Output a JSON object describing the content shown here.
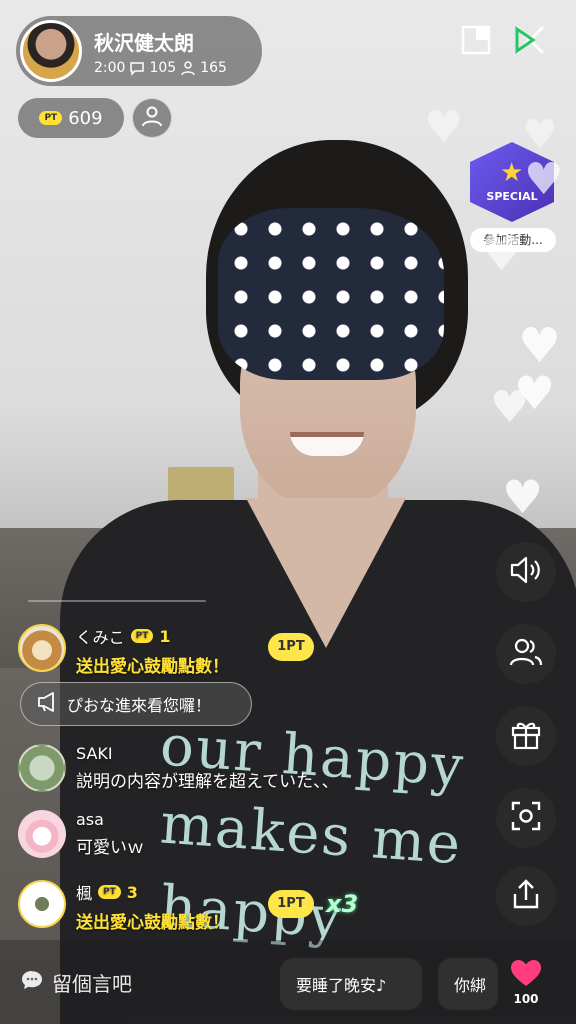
{
  "host": {
    "name": "秋沢健太朗",
    "duration": "2:00",
    "comments_count": "105",
    "viewers_count": "165"
  },
  "points": {
    "badge": "PT",
    "value": "609"
  },
  "event": {
    "badge_text": "SPECIAL",
    "label": "參加活動..."
  },
  "shirt_text": [
    "our happy",
    "makes me",
    "happy"
  ],
  "comments": [
    {
      "user": "くみこ",
      "badge": "PT",
      "level": "1",
      "text": "送出愛心鼓勵點數！",
      "type": "gift",
      "chip": "1PT"
    },
    {
      "user": "SAKI",
      "text": "説明の内容が理解を超えていた、、",
      "type": "chat"
    },
    {
      "user": "asa",
      "text": "可愛いｗ",
      "type": "chat"
    },
    {
      "user": "楓",
      "badge": "PT",
      "level": "3",
      "text": "送出愛心鼓勵點數！",
      "type": "gift",
      "chip": "1PT",
      "combo": "x3"
    }
  ],
  "notice": "ぴおな進來看您囉！",
  "bottom": {
    "input_placeholder": "留個言吧",
    "quick_replies": [
      "要睡了晚安♪",
      "你綁"
    ],
    "like_count": "100"
  },
  "colors": {
    "accent_yellow": "#ffe135",
    "like_pink": "#ff3d7f",
    "special_purple": "#5b3fd1"
  },
  "icons": [
    "comment-icon",
    "viewer-icon",
    "user-icon",
    "pip-icon",
    "close-icon",
    "speaker-icon",
    "people-icon",
    "gift-icon",
    "camera-flip-icon",
    "share-icon",
    "heart-icon",
    "chat-bubble-icon",
    "megaphone-icon"
  ]
}
